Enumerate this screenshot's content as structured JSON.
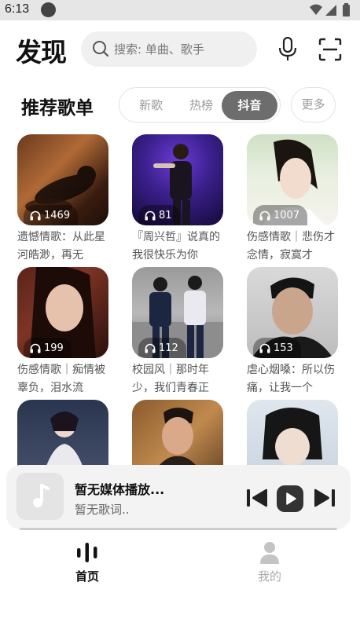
{
  "status_bar": {
    "time": "6:13"
  },
  "header": {
    "logo": "发现",
    "search_placeholder": "搜索: 单曲、歌手",
    "mic_icon": "microphone-icon",
    "scan_icon": "scan-icon"
  },
  "section": {
    "title": "推荐歌单",
    "tabs": [
      {
        "label": "新歌",
        "active": false
      },
      {
        "label": "热榜",
        "active": false
      },
      {
        "label": "抖音",
        "active": true
      }
    ],
    "more_label": "更多"
  },
  "playlists": [
    {
      "count": "1469",
      "title": "遗憾情歌：从此星河皓渺，再无"
    },
    {
      "count": "81",
      "title": "『周兴哲』说真的我很快乐为你"
    },
    {
      "count": "1007",
      "title": "伤感情歌｜悲伤才念情，寂寞才"
    },
    {
      "count": "199",
      "title": "伤感情歌｜痴情被辜负，泪水流"
    },
    {
      "count": "112",
      "title": "校园风｜那时年少，我们青春正"
    },
    {
      "count": "153",
      "title": "虐心烟嗓：所以伤痛，让我一个"
    },
    {
      "count": "",
      "title": ""
    },
    {
      "count": "",
      "title": ""
    },
    {
      "count": "",
      "title": ""
    }
  ],
  "player": {
    "title": "暂无媒体播放...",
    "lyric": "暂无歌词..",
    "icons": [
      "skip-previous-icon",
      "play-icon",
      "skip-next-icon"
    ]
  },
  "nav": [
    {
      "label": "首页",
      "active": true
    },
    {
      "label": "我的",
      "active": false
    }
  ]
}
